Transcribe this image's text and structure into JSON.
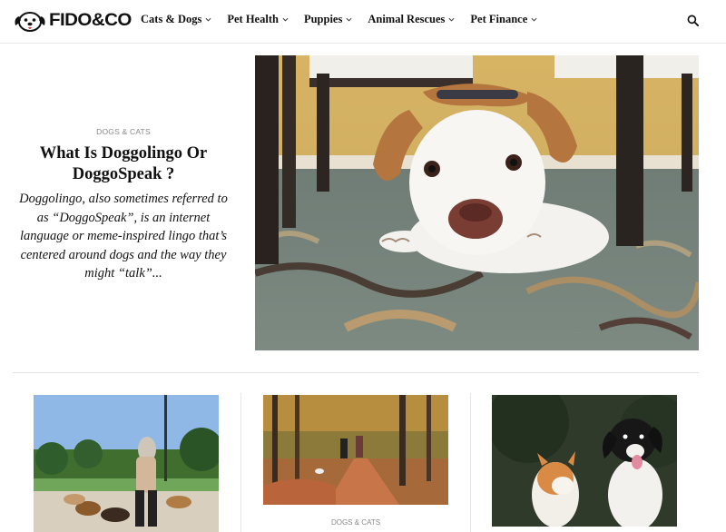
{
  "header": {
    "logo_text": "FIDO&CO",
    "nav": [
      {
        "label": "Cats & Dogs"
      },
      {
        "label": "Pet Health"
      },
      {
        "label": "Puppies"
      },
      {
        "label": "Animal Rescues"
      },
      {
        "label": "Pet Finance"
      }
    ]
  },
  "hero": {
    "category": "DOGS & CATS",
    "title": "What Is Doggolingo Or DoggoSpeak ?",
    "excerpt": "Doggolingo, also sometimes referred to as “DoggoSpeak”, is an internet language or meme-inspired lingo that’s centered around dogs and the way they might “talk”..."
  },
  "cards": [
    {
      "category": ""
    },
    {
      "category": "DOGS & CATS"
    },
    {
      "category": ""
    }
  ],
  "colors": {
    "text": "#111111",
    "muted": "#888888",
    "divider": "#e3e3e3"
  },
  "icons": [
    "dog-logo-icon",
    "chevron-down-icon",
    "search-icon"
  ]
}
